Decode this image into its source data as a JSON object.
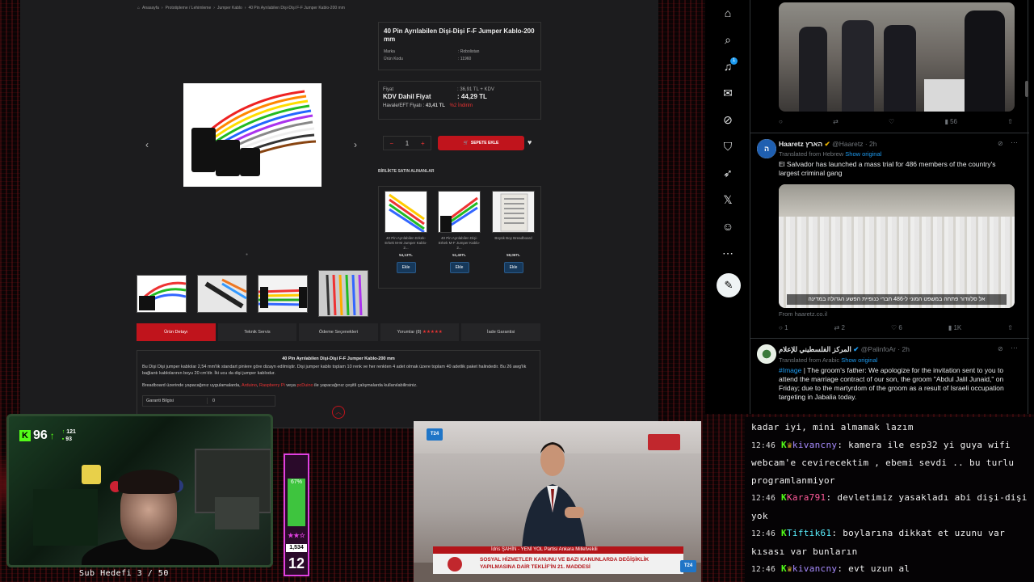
{
  "shop": {
    "breadcrumb": [
      "Anasayfa",
      "Prototipleme / Lehimleme",
      "Jumper Kablo",
      "40 Pin Ayrılabilen Dişi-Dişi F-F Jumper Kablo-200 mm"
    ],
    "product_title": "40 Pin Ayrılabilen Dişi-Dişi F-F Jumper Kablo-200 mm",
    "brand_label": "Marka",
    "brand_value": ": Robolistan",
    "code_label": "Ürün Kodu",
    "code_value": ": 11960",
    "price_label": "Fiyat",
    "price_value": ": 36,91 TL + KDV",
    "kdv_label": "KDV Dahil Fiyat",
    "kdv_value": ": 44,29 TL",
    "eft_label": "Havale/EFT Fiyatı :",
    "eft_value": "43,41 TL",
    "discount": "%2 İndirim",
    "qty_minus": "−",
    "qty_value": "1",
    "qty_plus": "+",
    "cart_button": "SEPETE EKLE",
    "bundle_title": "BİRLİKTE SATIN ALINANLAR",
    "bundle": [
      {
        "name": "40 Pin Ayrılabilen Erkek-Erkek M-M Jumper Kablo-2...",
        "price": "54,13TL",
        "btn": "Ekle"
      },
      {
        "name": "40 Pin Ayrılabilen Dişi-Erkek M-F Jumper Kablo-2...",
        "price": "51,40TL",
        "btn": "Ekle"
      },
      {
        "name": "Büyük Boy Breadboard",
        "price": "59,06TL",
        "btn": "Ekle"
      }
    ],
    "tabs": [
      "Ürün Detayı",
      "Teknik Servis",
      "Ödeme Seçenekleri",
      "Yorumlar (8)",
      "İade Garantisi"
    ],
    "tab_stars": "★★★★★",
    "desc_title": "40 Pin Ayrılabilen Dişi-Dişi F-F Jumper Kablo-200 mm",
    "desc_p1": "Bu Dişi Dişi jumper kablolar 2,54 mm'lik standart pinlere göre dizayn edilmiştir. Dişi jumper kablo toplam 10 renk ve her renkten 4 adet olmak üzere toplam 40 adetlik paket halindedir. Bu 26 awg'lik bağlantı kablolarının boyu 20 cm'dir. İki ucu da dişi jumper kablodur.",
    "desc_p2_pre": "Breadboard üzerinde yapacağınız uygulamalarda,",
    "desc_p2_a1": "Arduino",
    "desc_p2_sep1": ",",
    "desc_p2_a2": "Raspberry Pi",
    "desc_p2_sep2": "veya",
    "desc_p2_a3": "pcDuino",
    "desc_p2_post": "ile yapacağınız çeşitli çalışmalarda kullanılabilirsiniz.",
    "warranty_label": "Garanti Bilgisi",
    "warranty_value": "0"
  },
  "twitter": {
    "nav_icons": [
      "home-icon",
      "search-icon",
      "bell-icon",
      "message-icon",
      "grok-icon",
      "bookmark-icon",
      "rocket-icon",
      "x-icon",
      "profile-icon",
      "more-icon",
      "compose-icon"
    ],
    "notif_count": "1",
    "post1": {
      "views": "56"
    },
    "post2": {
      "name": "Haaretz הארץ",
      "handle": "@Haaretz · 2h",
      "translated": "Translated from Hebrew",
      "show_original": "Show original",
      "text": "El Salvador has launched a mass trial for 486 members of the country's largest criminal gang",
      "caption": "אל סלוודור פתחה במשפט המוני ל-486 חברי כנופיית הפשע הגדולה במדינה",
      "source": "From haaretz.co.il",
      "replies": "1",
      "reposts": "2",
      "likes": "6",
      "views": "1K"
    },
    "post3": {
      "name": "المركز الفلسطيني للإعلام",
      "handle": "@PalinfoAr · 2h",
      "translated": "Translated from Arabic",
      "show_original": "Show original",
      "hashtag": "#Image",
      "text": "| The groom's father: We apologize for the invitation sent to you to attend the marriage contract of our son, the groom \"Abdul Jalil Junaid,\" on Friday; due to the martyrdom of the groom as a result of Israeli occupation targeting in Jabalia today."
    }
  },
  "stream": {
    "viewers": "96",
    "count_a": "121",
    "count_b": "93",
    "sub_goal": "Sub Hedefi 3 / 50",
    "meter_pct": "67%",
    "meter_fill": 0.67,
    "meter_stars": "★★☆",
    "meter_count": "1,534",
    "meter_level": "12"
  },
  "tv": {
    "logo_left": "T24",
    "logo_right": "T24",
    "speaker": "İdris ŞAHİN - YENİ YOL Partisi Ankara Milletvekili",
    "headline1": "SOSYAL HİZMETLER KANUNU VE BAZI KANUNLARDA DEĞİŞİKLİK",
    "headline2": "YAPILMASINA DAİR TEKLİF'İN 21. MADDESİ"
  },
  "chat": {
    "line0": "kadar iyi, mini almamak lazım",
    "messages": [
      {
        "time": "12:46",
        "user": "kivancny",
        "text": "kamera ile esp32 yi guya wifi webcam'e cevirecektim , ebemi sevdi .. bu turlu programlanmiyor"
      },
      {
        "time": "12:46",
        "user": "Kara791",
        "text": "devletimiz yasakladı abi dişi-dişi yok"
      },
      {
        "time": "12:46",
        "user": "Tiftik61",
        "text": "boylarına dikkat et uzunu var kısası var bunların"
      },
      {
        "time": "12:46",
        "user": "kivancny",
        "text": "evt uzun al"
      }
    ]
  },
  "colors": {
    "accent_red": "#c0141c",
    "kick_green": "#53fc18",
    "twitter_blue": "#1d9bf0"
  }
}
